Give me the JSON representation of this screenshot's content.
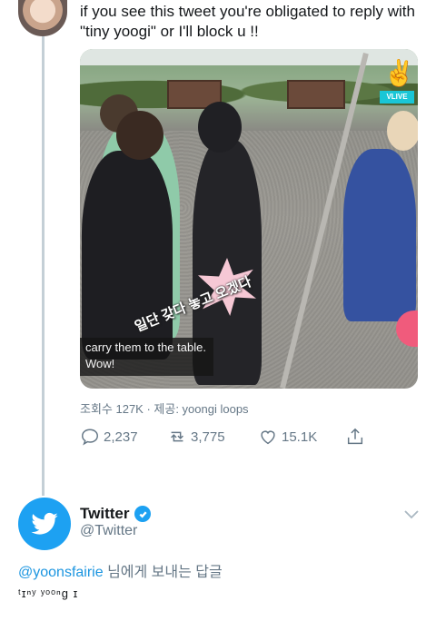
{
  "tweet": {
    "text": "if you see this tweet you're obligated to reply with \"tiny yoogi\" or I'll block u !!",
    "video": {
      "badge": "VLIVE",
      "korean_caption": "일단 갖다 놓고 오겠다",
      "subtitle_line1": "carry them to the table.",
      "subtitle_line2": "Wow!"
    },
    "meta": "조회수 127K · 제공: yoongi loops",
    "actions": {
      "replies": "2,237",
      "retweets": "3,775",
      "likes": "15.1K"
    }
  },
  "reply": {
    "name": "Twitter",
    "handle": "@Twitter",
    "replying_mention": "@yoonsfairie",
    "replying_suffix": " 님에게 보내는 답글",
    "text": "ᵗɪⁿʸ ʸᵒᵒⁿɡ ɪ"
  },
  "colors": {
    "twitter_blue": "#1da1f2",
    "link_blue": "#1b95e0",
    "secondary_text": "#657786"
  },
  "icons": [
    "reply-icon",
    "retweet-icon",
    "like-icon",
    "share-icon",
    "twitter-bird-icon",
    "verified-badge-icon",
    "chevron-down-icon"
  ]
}
